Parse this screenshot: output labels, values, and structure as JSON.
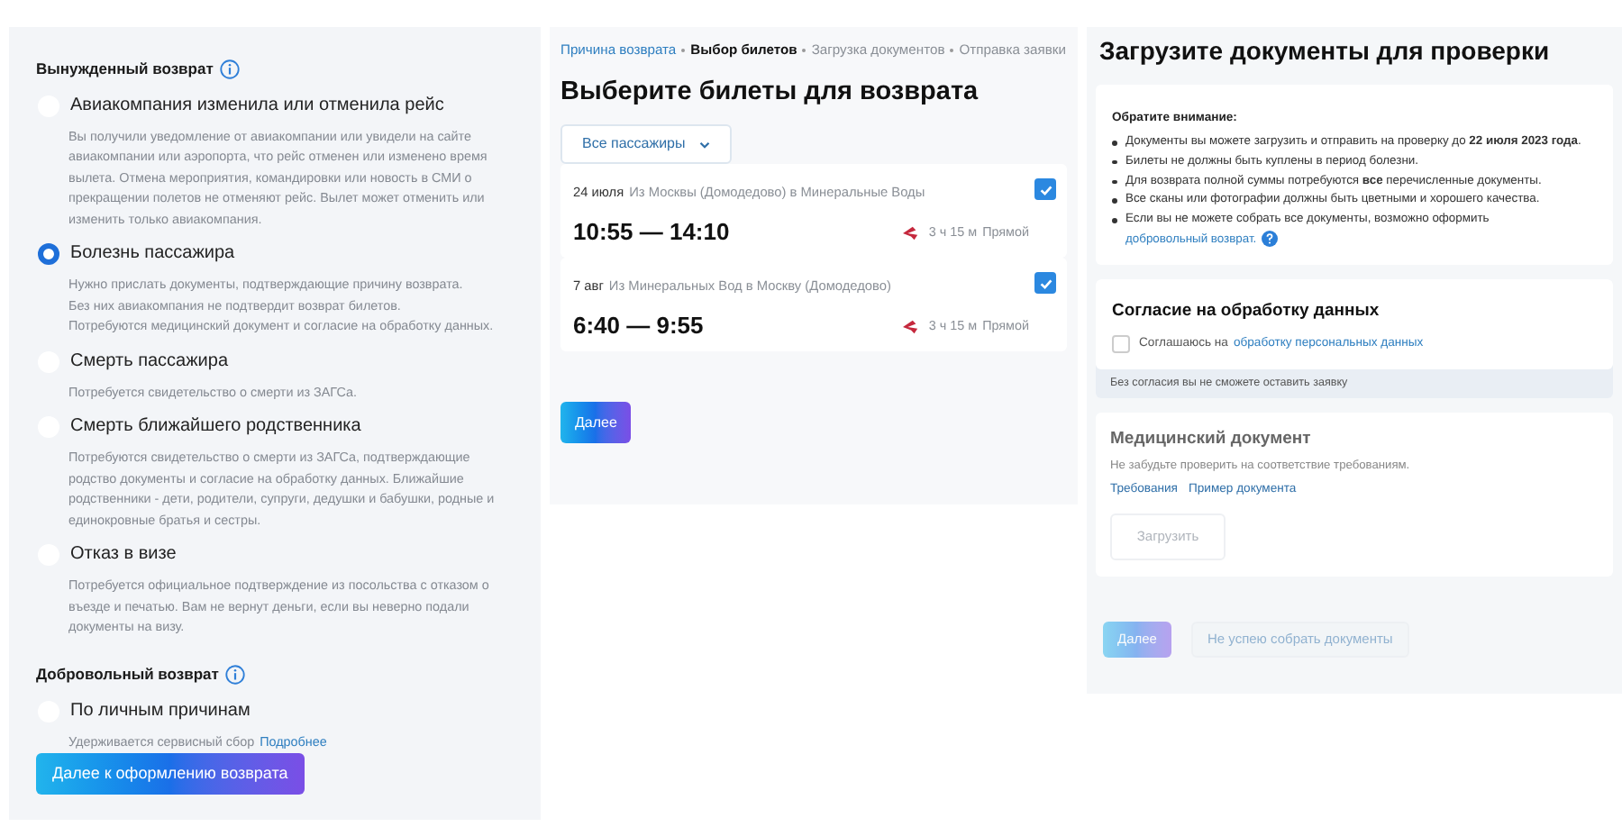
{
  "reason_panel": {
    "sections": [
      {
        "title": "Вынужденный возврат",
        "info": true,
        "options": [
          {
            "label": "Авиакомпания изменила или отменила рейс",
            "selected": false,
            "description": "Вы получили уведомление от авиакомпании или увидели на сайте авиакомпании или аэропорта, что рейс отменен или изменено время вылета. Отмена мероприятия, командировки или новость в СМИ о прекращении полетов не отменяют рейс. Вылет может отменить или изменить только авиакомпания."
          },
          {
            "label": "Болезнь пассажира",
            "selected": true,
            "description": "Нужно прислать документы, подтверждающие причину возврата.\nБез них авиакомпания не подтвердит возврат билетов.\nПотребуются медицинский документ и согласие на обработку данных."
          },
          {
            "label": "Смерть пассажира",
            "selected": false,
            "description": "Потребуется свидетельство о смерти из ЗАГСа."
          },
          {
            "label": "Смерть ближайшего родственника",
            "selected": false,
            "description": "Потребуются свидетельство о смерти из ЗАГСа, подтверждающие родство документы и согласие на обработку данных. Ближайшие родственники - дети, родители, супруги, дедушки и бабушки, родные и единокровные братья и сестры."
          },
          {
            "label": "Отказ в  визе",
            "selected": false,
            "description": "Потребуется официальное подтверждение из посольства с отказом о въезде и печатью. Вам не вернут деньги, если вы неверно подали документы на визу."
          }
        ]
      },
      {
        "title": "Добровольный возврат",
        "info": true,
        "options": [
          {
            "label": "По личным причинам",
            "selected": false,
            "description": "Удерживается сервисный сбор",
            "link": "Подробнее"
          }
        ]
      }
    ],
    "button": "Далее к оформлению возврата"
  },
  "tickets_panel": {
    "breadcrumbs": [
      {
        "label": "Причина возврата",
        "kind": "done"
      },
      {
        "label": "Выбор билетов",
        "kind": "current"
      },
      {
        "label": "Загрузка документов",
        "kind": "todo"
      },
      {
        "label": "Отправка заявки",
        "kind": "todo"
      }
    ],
    "title": "Выберите билеты для возврата",
    "passenger_filter": "Все пассажиры",
    "tickets": [
      {
        "date": "24 июля",
        "route": "Из Москвы (Домодедово) в Минеральные Воды",
        "times": "10:55 — 14:10",
        "duration": "3 ч 15 м",
        "type": "Прямой",
        "checked": true
      },
      {
        "date": "7 авг",
        "route": "Из Минеральных Вод в Москву (Домодедово)",
        "times": "6:40 — 9:55",
        "duration": "3 ч 15 м",
        "type": "Прямой",
        "checked": true
      }
    ],
    "button": "Далее"
  },
  "documents_panel": {
    "title": "Загрузите документы для проверки",
    "notice": {
      "title": "Обратите внимание:",
      "items": [
        {
          "text": "Документы вы можете загрузить и отправить на проверку до **22 июля 2023 года**."
        },
        {
          "text": "Билеты не должны быть куплены в период болезни."
        },
        {
          "text": "Для возврата полной суммы потребуются **все** перечисленные документы."
        },
        {
          "text": "Все сканы или фотографии должны быть цветными и хорошего качества."
        },
        {
          "text": "Если вы не можете собрать все документы, возможно оформить",
          "link": "добровольный возврат.",
          "help": true
        }
      ]
    },
    "consent": {
      "title": "Согласие на обработку данных",
      "label": "Соглашаюсь на",
      "link": "обработку персональных данных",
      "checked": false,
      "hint": "Без согласия вы не сможете оставить заявку"
    },
    "medical": {
      "title": "Медицинский документ",
      "text": "Не забудьте проверить на соответствие требованиям.",
      "links": [
        "Требования",
        "Пример документа"
      ],
      "upload_button": "Загрузить"
    },
    "buttons": [
      {
        "label": "Далее",
        "kind": "primary",
        "disabled": true
      },
      {
        "label": "Не успею собрать документы",
        "kind": "secondary",
        "disabled": true
      }
    ]
  }
}
